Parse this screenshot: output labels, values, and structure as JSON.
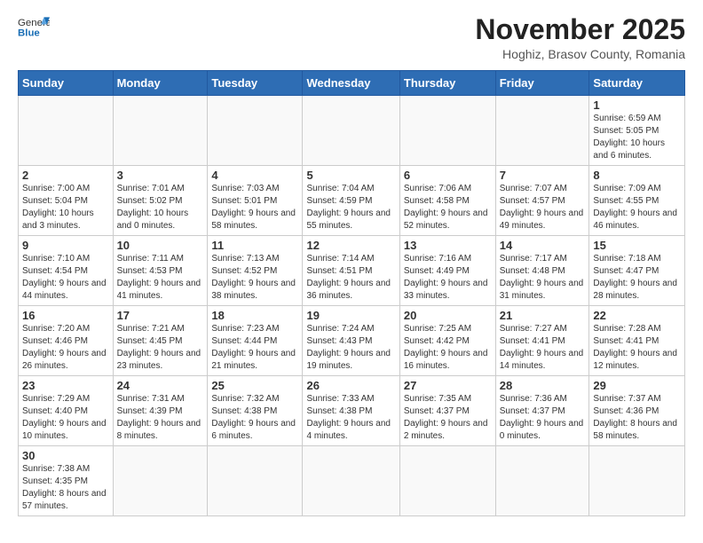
{
  "header": {
    "logo_general": "General",
    "logo_blue": "Blue",
    "month_title": "November 2025",
    "subtitle": "Hoghiz, Brasov County, Romania"
  },
  "days_of_week": [
    "Sunday",
    "Monday",
    "Tuesday",
    "Wednesday",
    "Thursday",
    "Friday",
    "Saturday"
  ],
  "weeks": [
    [
      {
        "num": "",
        "info": ""
      },
      {
        "num": "",
        "info": ""
      },
      {
        "num": "",
        "info": ""
      },
      {
        "num": "",
        "info": ""
      },
      {
        "num": "",
        "info": ""
      },
      {
        "num": "",
        "info": ""
      },
      {
        "num": "1",
        "info": "Sunrise: 6:59 AM\nSunset: 5:05 PM\nDaylight: 10 hours and 6 minutes."
      }
    ],
    [
      {
        "num": "2",
        "info": "Sunrise: 7:00 AM\nSunset: 5:04 PM\nDaylight: 10 hours and 3 minutes."
      },
      {
        "num": "3",
        "info": "Sunrise: 7:01 AM\nSunset: 5:02 PM\nDaylight: 10 hours and 0 minutes."
      },
      {
        "num": "4",
        "info": "Sunrise: 7:03 AM\nSunset: 5:01 PM\nDaylight: 9 hours and 58 minutes."
      },
      {
        "num": "5",
        "info": "Sunrise: 7:04 AM\nSunset: 4:59 PM\nDaylight: 9 hours and 55 minutes."
      },
      {
        "num": "6",
        "info": "Sunrise: 7:06 AM\nSunset: 4:58 PM\nDaylight: 9 hours and 52 minutes."
      },
      {
        "num": "7",
        "info": "Sunrise: 7:07 AM\nSunset: 4:57 PM\nDaylight: 9 hours and 49 minutes."
      },
      {
        "num": "8",
        "info": "Sunrise: 7:09 AM\nSunset: 4:55 PM\nDaylight: 9 hours and 46 minutes."
      }
    ],
    [
      {
        "num": "9",
        "info": "Sunrise: 7:10 AM\nSunset: 4:54 PM\nDaylight: 9 hours and 44 minutes."
      },
      {
        "num": "10",
        "info": "Sunrise: 7:11 AM\nSunset: 4:53 PM\nDaylight: 9 hours and 41 minutes."
      },
      {
        "num": "11",
        "info": "Sunrise: 7:13 AM\nSunset: 4:52 PM\nDaylight: 9 hours and 38 minutes."
      },
      {
        "num": "12",
        "info": "Sunrise: 7:14 AM\nSunset: 4:51 PM\nDaylight: 9 hours and 36 minutes."
      },
      {
        "num": "13",
        "info": "Sunrise: 7:16 AM\nSunset: 4:49 PM\nDaylight: 9 hours and 33 minutes."
      },
      {
        "num": "14",
        "info": "Sunrise: 7:17 AM\nSunset: 4:48 PM\nDaylight: 9 hours and 31 minutes."
      },
      {
        "num": "15",
        "info": "Sunrise: 7:18 AM\nSunset: 4:47 PM\nDaylight: 9 hours and 28 minutes."
      }
    ],
    [
      {
        "num": "16",
        "info": "Sunrise: 7:20 AM\nSunset: 4:46 PM\nDaylight: 9 hours and 26 minutes."
      },
      {
        "num": "17",
        "info": "Sunrise: 7:21 AM\nSunset: 4:45 PM\nDaylight: 9 hours and 23 minutes."
      },
      {
        "num": "18",
        "info": "Sunrise: 7:23 AM\nSunset: 4:44 PM\nDaylight: 9 hours and 21 minutes."
      },
      {
        "num": "19",
        "info": "Sunrise: 7:24 AM\nSunset: 4:43 PM\nDaylight: 9 hours and 19 minutes."
      },
      {
        "num": "20",
        "info": "Sunrise: 7:25 AM\nSunset: 4:42 PM\nDaylight: 9 hours and 16 minutes."
      },
      {
        "num": "21",
        "info": "Sunrise: 7:27 AM\nSunset: 4:41 PM\nDaylight: 9 hours and 14 minutes."
      },
      {
        "num": "22",
        "info": "Sunrise: 7:28 AM\nSunset: 4:41 PM\nDaylight: 9 hours and 12 minutes."
      }
    ],
    [
      {
        "num": "23",
        "info": "Sunrise: 7:29 AM\nSunset: 4:40 PM\nDaylight: 9 hours and 10 minutes."
      },
      {
        "num": "24",
        "info": "Sunrise: 7:31 AM\nSunset: 4:39 PM\nDaylight: 9 hours and 8 minutes."
      },
      {
        "num": "25",
        "info": "Sunrise: 7:32 AM\nSunset: 4:38 PM\nDaylight: 9 hours and 6 minutes."
      },
      {
        "num": "26",
        "info": "Sunrise: 7:33 AM\nSunset: 4:38 PM\nDaylight: 9 hours and 4 minutes."
      },
      {
        "num": "27",
        "info": "Sunrise: 7:35 AM\nSunset: 4:37 PM\nDaylight: 9 hours and 2 minutes."
      },
      {
        "num": "28",
        "info": "Sunrise: 7:36 AM\nSunset: 4:37 PM\nDaylight: 9 hours and 0 minutes."
      },
      {
        "num": "29",
        "info": "Sunrise: 7:37 AM\nSunset: 4:36 PM\nDaylight: 8 hours and 58 minutes."
      }
    ],
    [
      {
        "num": "30",
        "info": "Sunrise: 7:38 AM\nSunset: 4:35 PM\nDaylight: 8 hours and 57 minutes."
      },
      {
        "num": "",
        "info": ""
      },
      {
        "num": "",
        "info": ""
      },
      {
        "num": "",
        "info": ""
      },
      {
        "num": "",
        "info": ""
      },
      {
        "num": "",
        "info": ""
      },
      {
        "num": "",
        "info": ""
      }
    ]
  ]
}
